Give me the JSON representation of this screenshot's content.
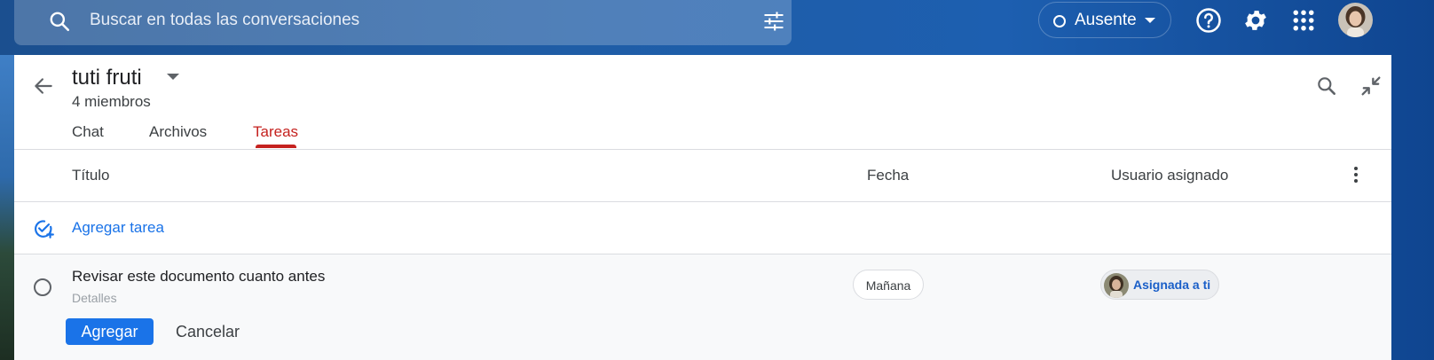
{
  "topbar": {
    "search_placeholder": "Buscar en todas las conversaciones",
    "status_label": "Ausente",
    "icons": [
      "search-icon",
      "filter-icon",
      "help-icon",
      "gear-icon",
      "apps-icon",
      "avatar"
    ]
  },
  "room": {
    "title": "tuti fruti",
    "members": "4 miembros",
    "tabs": [
      {
        "label": "Chat"
      },
      {
        "label": "Archivos"
      },
      {
        "label": "Tareas",
        "active": true
      }
    ]
  },
  "tasks": {
    "columns": {
      "title": "Título",
      "date": "Fecha",
      "assignee": "Usuario asignado"
    },
    "add_task_label": "Agregar tarea",
    "editing": {
      "title": "Revisar este documento cuanto antes",
      "details_placeholder": "Detalles",
      "date_chip": "Mañana",
      "assignee_chip": "Asignada a ti",
      "add_button": "Agregar",
      "cancel_button": "Cancelar"
    }
  },
  "colors": {
    "accent": "#1a73e8",
    "active_tab": "#c5221f"
  }
}
